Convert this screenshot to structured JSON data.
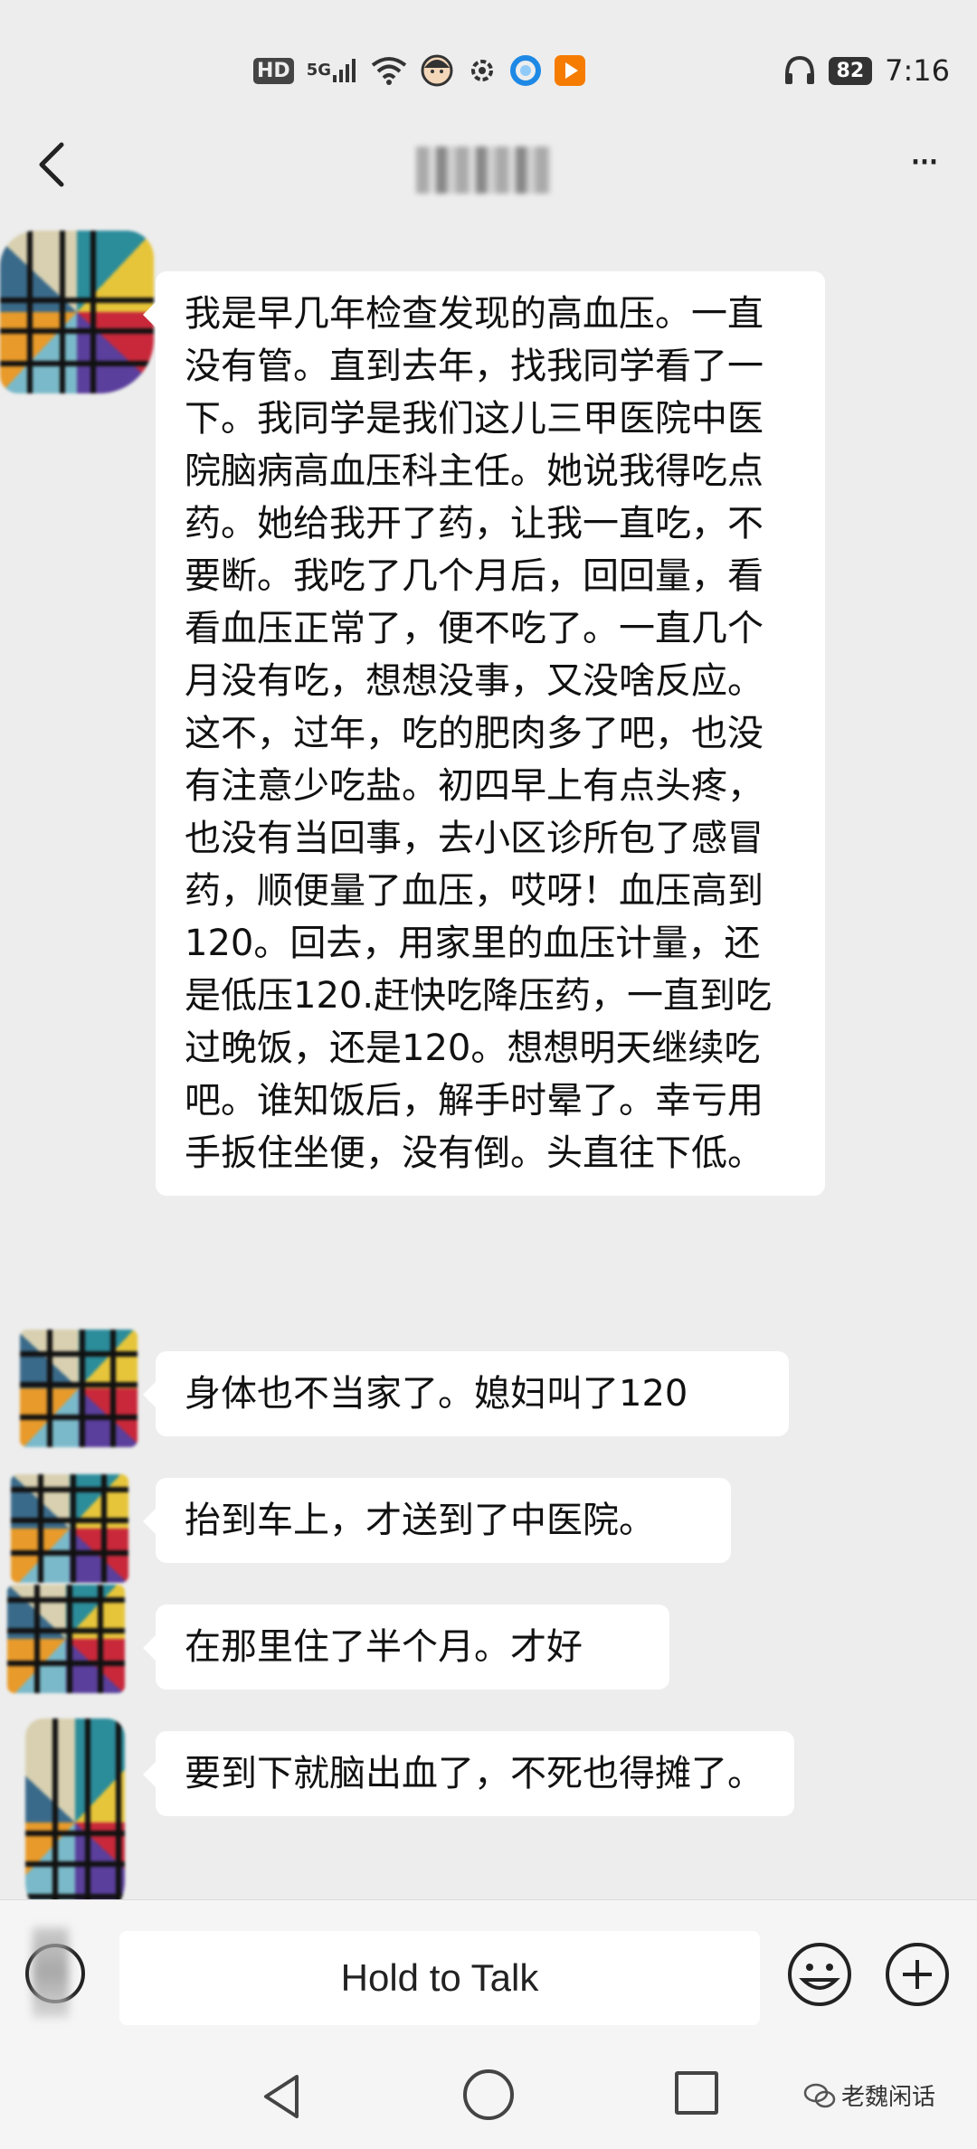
{
  "status_bar": {
    "hd": "HD",
    "network": "5G",
    "battery": "82",
    "time": "7:16",
    "icons": [
      "hd-icon",
      "5g-signal-icon",
      "wifi-icon",
      "app-avatar-icon",
      "gear-icon",
      "app-circle-icon",
      "app-play-icon",
      "headphones-icon",
      "battery-icon"
    ]
  },
  "nav": {
    "back_icon": "chevron-left-icon",
    "more_label": "···"
  },
  "messages": [
    {
      "text": "我是早几年检查发现的高血压。一直没有管。直到去年，找我同学看了一下。我同学是我们这儿三甲医院中医院脑病高血压科主任。她说我得吃点药。她给我开了药，让我一直吃，不要断。我吃了几个月后，回回量，看看血压正常了，便不吃了。一直几个月没有吃，想想没事，又没啥反应。这不，过年，吃的肥肉多了吧，也没有注意少吃盐。初四早上有点头疼，也没有当回事，去小区诊所包了感冒药，顺便量了血压，哎呀！血压高到120。回去，用家里的血压计量，还是低压120.赶快吃降压药，一直到吃过晚饭，还是120。想想明天继续吃吧。谁知饭后，解手时晕了。幸亏用手扳住坐便，没有倒。头直往下低。"
    },
    {
      "text": "身体也不当家了。媳妇叫了120"
    },
    {
      "text": "抬到车上，才送到了中医院。"
    },
    {
      "text": "在那里住了半个月。才好"
    },
    {
      "text": "要到下就脑出血了，不死也得摊了。"
    }
  ],
  "input_bar": {
    "hold_to_talk": "Hold to Talk",
    "voice_icon": "voice-toggle-icon",
    "emoji_icon": "emoji-icon",
    "plus_icon": "plus-icon"
  },
  "system_nav": {
    "back": "triangle-back-icon",
    "home": "circle-home-icon",
    "recent": "square-recent-icon"
  },
  "watermark": {
    "text": "老魏闲话"
  }
}
